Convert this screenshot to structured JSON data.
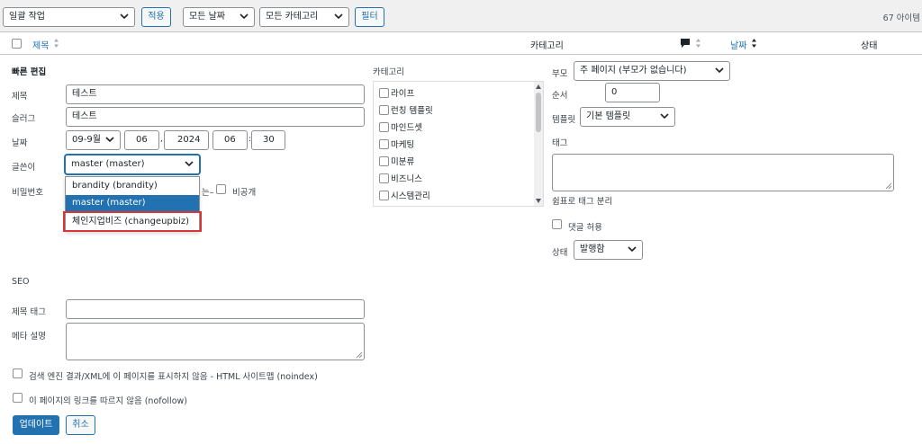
{
  "top": {
    "bulk_action": "일괄 작업",
    "apply": "적용",
    "dates": "모든 날짜",
    "categories": "모든 카테고리",
    "filter": "필터",
    "item_count": "67 아이템"
  },
  "table_header": {
    "title": "제목",
    "category": "카테고리",
    "date": "날짜",
    "status": "상태"
  },
  "quick_edit": {
    "heading": "빠른 편집",
    "labels": {
      "title": "제목",
      "slug": "슬러그",
      "date": "날짜",
      "author": "글쓴이",
      "password": "비밀번호",
      "private": "비공개",
      "or_sep": "는–"
    },
    "title_value": "테스트",
    "slug_value": "테스트",
    "date": {
      "month": "09-9월",
      "day": "06",
      "year": "2024",
      "hour": "06",
      "minute": "30"
    },
    "author_value": "master (master)",
    "author_options": [
      "brandity (brandity)",
      "master (master)",
      "체인지업비즈 (changeupbiz)"
    ],
    "author_highlighted": "master (master)",
    "author_boxed": "체인지업비즈 (changeupbiz)",
    "highlight_color": "#2271b1",
    "box_color": "#d63638"
  },
  "category_panel": {
    "heading": "카테고리",
    "items": [
      "라이프",
      "런칭 템플릿",
      "마인드셋",
      "마케팅",
      "미분류",
      "비즈니스",
      "시스템관리"
    ]
  },
  "right_panel": {
    "parent_label": "부모",
    "parent_value": "주 페이지 (부모가 없습니다)",
    "order_label": "순서",
    "order_value": "0",
    "template_label": "템플릿",
    "template_value": "기본 템플릿",
    "tags_label": "태그",
    "tags_hint": "쉼표로 태그 분리",
    "allow_comments": "댓글 허용",
    "status_label": "상태",
    "status_value": "발행함"
  },
  "seo": {
    "heading": "SEO",
    "title_tag_label": "제목 태그",
    "meta_desc_label": "메타 설명",
    "noindex": "검색 엔진 결과/XML에 이 페이지를 표시하지 않음 - HTML 사이트맵 (noindex)",
    "nofollow": "이 페이지의 링크를 따르지 않음 (nofollow)"
  },
  "actions": {
    "update": "업데이트",
    "cancel": "취소"
  },
  "colors": {
    "primary": "#2271b1",
    "link": "#2271b1",
    "text": "#1d2327"
  }
}
